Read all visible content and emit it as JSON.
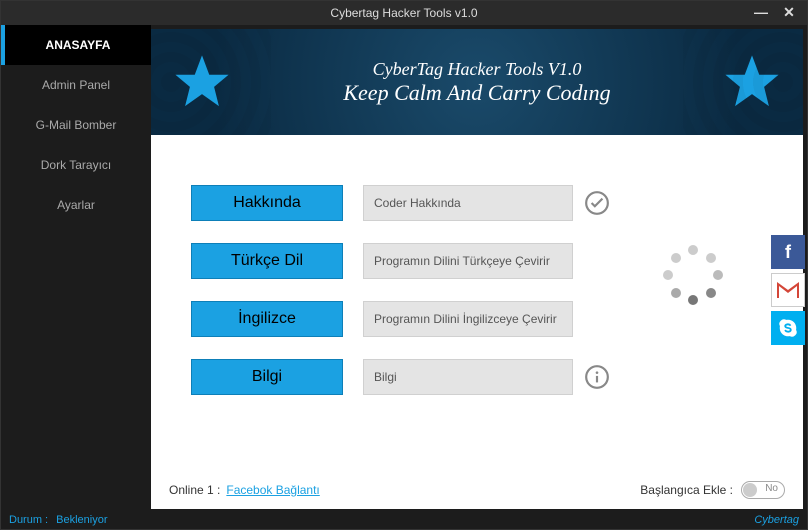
{
  "window": {
    "title": "Cybertag Hacker Tools v1.0"
  },
  "sidebar": {
    "items": [
      {
        "label": "ANASAYFA",
        "active": true
      },
      {
        "label": "Admin Panel",
        "active": false
      },
      {
        "label": "G-Mail Bomber",
        "active": false
      },
      {
        "label": "Dork Tarayıcı",
        "active": false
      },
      {
        "label": "Ayarlar",
        "active": false
      }
    ]
  },
  "banner": {
    "title": "CyberTag Hacker Tools V1.0",
    "subtitle": "Keep Calm And Carry Codıng"
  },
  "rows": [
    {
      "button": "Hakkında",
      "desc": "Coder Hakkında",
      "icon": "check"
    },
    {
      "button": "Türkçe Dil",
      "desc": "Programın Dilini Türkçeye Çevirir",
      "icon": ""
    },
    {
      "button": "İngilizce",
      "desc": "Programın Dilini İngilizceye Çevirir",
      "icon": ""
    },
    {
      "button": "Bilgi",
      "desc": "Bilgi",
      "icon": "info"
    }
  ],
  "bottom": {
    "online_label": "Online 1 :",
    "link_text": "Facebok Bağlantı",
    "startup_label": "Başlangıca Ekle :",
    "toggle_text": "No"
  },
  "status": {
    "left_label": "Durum :",
    "left_value": "Bekleniyor",
    "right": "Cybertag"
  }
}
